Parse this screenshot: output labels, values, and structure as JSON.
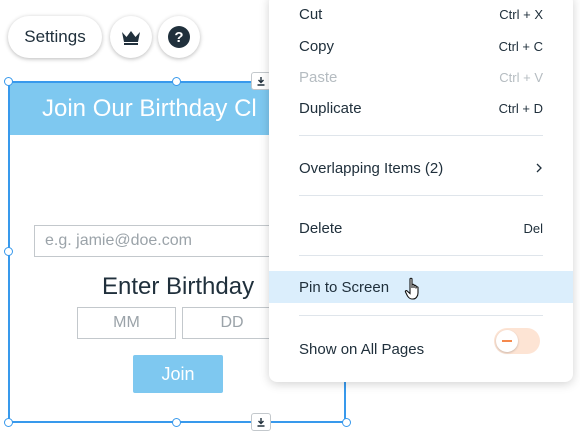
{
  "toolbar": {
    "settings_label": "Settings",
    "upgrade_icon": "crown-icon",
    "help_icon": "help-icon",
    "help_glyph": "?"
  },
  "widget": {
    "header_text": "Join Our Birthday Cl",
    "email_placeholder": "e.g. jamie@doe.com",
    "enter_birthday": "Enter Birthday",
    "month_placeholder": "MM",
    "day_placeholder": "DD",
    "join_label": "Join",
    "colors": {
      "accent": "#7ec8f0",
      "selection": "#3899ec"
    }
  },
  "context_menu": {
    "cut": {
      "label": "Cut",
      "shortcut": "Ctrl + X"
    },
    "copy": {
      "label": "Copy",
      "shortcut": "Ctrl + C"
    },
    "paste": {
      "label": "Paste",
      "shortcut": "Ctrl + V",
      "disabled": true
    },
    "duplicate": {
      "label": "Duplicate",
      "shortcut": "Ctrl + D"
    },
    "overlapping": {
      "label": "Overlapping Items (2)",
      "icon": "chevron-right-icon"
    },
    "delete": {
      "label": "Delete",
      "shortcut": "Del"
    },
    "pin": {
      "label": "Pin to Screen",
      "highlighted": true
    },
    "show_all_pages": {
      "label": "Show on All Pages",
      "toggle_on": false
    },
    "colors": {
      "highlight": "#dbeefc",
      "toggle_off": "#f5894d"
    }
  }
}
